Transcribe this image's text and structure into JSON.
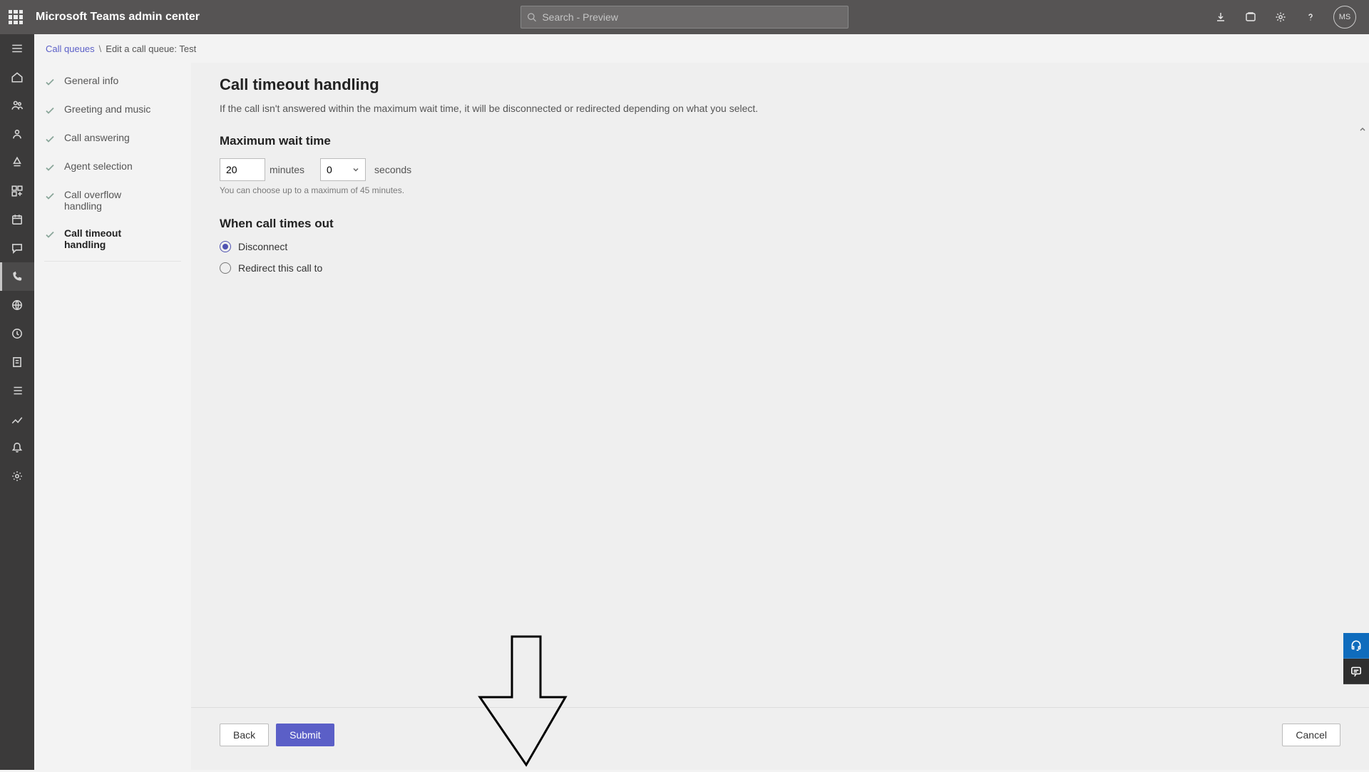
{
  "header": {
    "app_title": "Microsoft Teams admin center",
    "search_placeholder": "Search - Preview",
    "avatar_initials": "MS"
  },
  "breadcrumb": {
    "root_label": "Call queues",
    "separator": "\\",
    "current_label": "Edit a call queue: Test"
  },
  "steps": [
    {
      "label": "General info"
    },
    {
      "label": "Greeting and music"
    },
    {
      "label": "Call answering"
    },
    {
      "label": "Agent selection"
    },
    {
      "label": "Call overflow handling"
    },
    {
      "label": "Call timeout handling"
    }
  ],
  "page": {
    "title": "Call timeout handling",
    "description": "If the call isn't answered within the maximum wait time, it will be disconnected or redirected depending on what you select.",
    "max_wait": {
      "heading": "Maximum wait time",
      "minutes_value": "20",
      "minutes_unit": "minutes",
      "seconds_value": "0",
      "seconds_unit": "seconds",
      "helper": "You can choose up to a maximum of 45 minutes."
    },
    "timeout_action": {
      "heading": "When call times out",
      "options": {
        "disconnect": "Disconnect",
        "redirect": "Redirect this call to"
      },
      "selected": "disconnect"
    }
  },
  "footer": {
    "back": "Back",
    "submit": "Submit",
    "cancel": "Cancel"
  }
}
